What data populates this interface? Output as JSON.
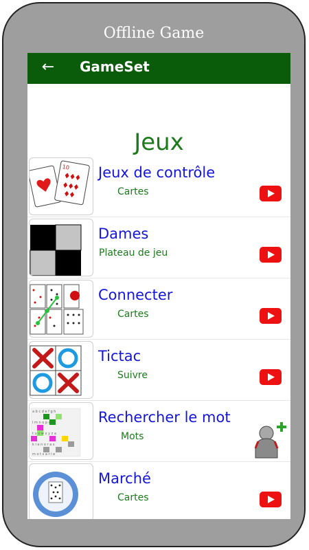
{
  "frame": {
    "title": "Offline Game"
  },
  "appbar": {
    "back_icon": "arrow-left-icon",
    "title": "GameSet"
  },
  "main": {
    "heading": "Jeux",
    "games": [
      {
        "title": "Jeux de contrôle",
        "subtitle": "Cartes",
        "thumb": "playing-cards",
        "action": "youtube-icon"
      },
      {
        "title": "Dames",
        "subtitle": "Plateau de jeu",
        "thumb": "checkerboard",
        "action": "youtube-icon"
      },
      {
        "title": "Connecter",
        "subtitle": "Cartes",
        "thumb": "card-grid",
        "action": "youtube-icon"
      },
      {
        "title": "Tictac",
        "subtitle": "Suivre",
        "thumb": "tic-tac-toe",
        "action": "youtube-icon"
      },
      {
        "title": "Rechercher le mot",
        "subtitle": "Mots",
        "thumb": "word-search-grid",
        "action": "add-user-icon"
      },
      {
        "title": "Marché",
        "subtitle": "Cartes",
        "thumb": "card-ring",
        "action": "youtube-icon"
      }
    ]
  },
  "colors": {
    "frame": "#9e9e9e",
    "appbar": "#0a5c0a",
    "heading": "#1c7a1c",
    "item_title": "#1515d9",
    "item_subtitle": "#1c7a1c",
    "youtube": "#ee1111"
  }
}
